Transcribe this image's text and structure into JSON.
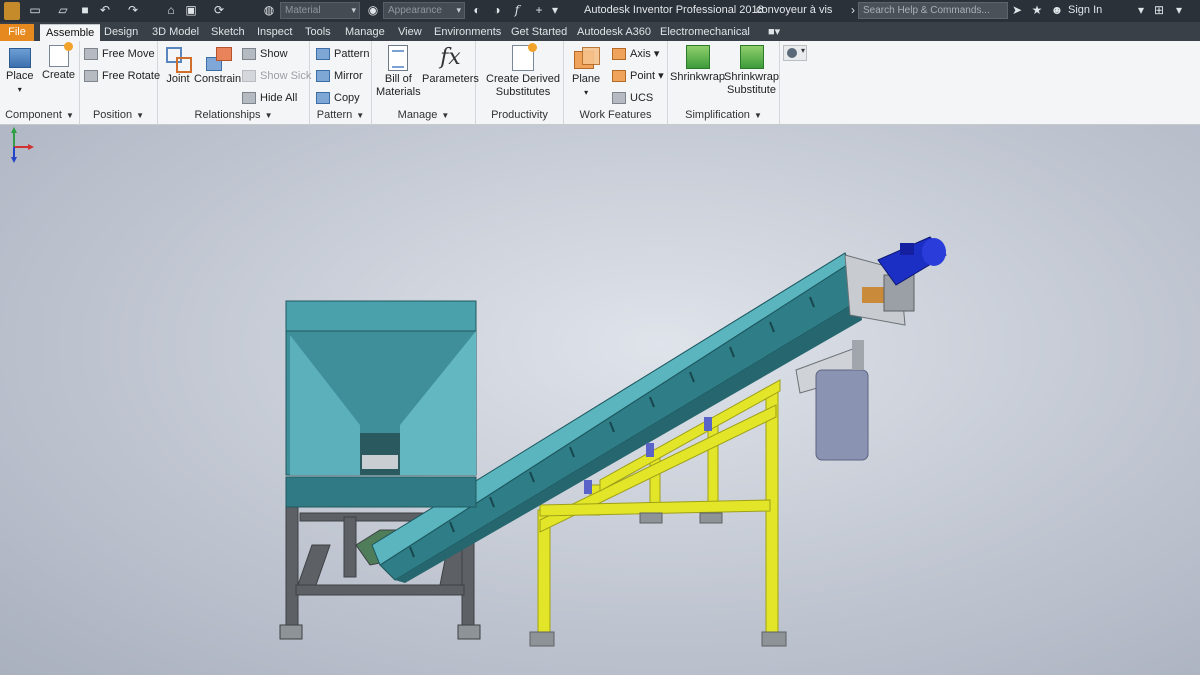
{
  "titlebar": {
    "app_title": "Autodesk Inventor Professional 2018",
    "document_title": "convoyeur à vis",
    "help_search_placeholder": "Search Help & Commands...",
    "sign_in": "Sign In",
    "material_combo": "Material",
    "appearance_combo": "Appearance"
  },
  "tabs": {
    "file": "File",
    "assemble": "Assemble",
    "design": "Design",
    "model3d": "3D Model",
    "sketch": "Sketch",
    "inspect": "Inspect",
    "tools": "Tools",
    "manage": "Manage",
    "view": "View",
    "environments": "Environments",
    "get_started": "Get Started",
    "a360": "Autodesk A360",
    "electromechanical": "Electromechanical"
  },
  "ribbon": {
    "component": {
      "title": "Component",
      "place": "Place",
      "create": "Create"
    },
    "position": {
      "title": "Position",
      "free_move": "Free Move",
      "free_rotate": "Free Rotate"
    },
    "relationships": {
      "title": "Relationships",
      "joint": "Joint",
      "constrain": "Constrain",
      "show": "Show",
      "show_sick": "Show Sick",
      "hide_all": "Hide All"
    },
    "pattern": {
      "title": "Pattern",
      "pattern": "Pattern",
      "mirror": "Mirror",
      "copy": "Copy"
    },
    "manage": {
      "title": "Manage",
      "bom_line1": "Bill of",
      "bom_line2": "Materials",
      "parameters": "Parameters"
    },
    "productivity": {
      "title": "Productivity",
      "derived_line1": "Create Derived",
      "derived_line2": "Substitutes"
    },
    "work_features": {
      "title": "Work Features",
      "plane": "Plane",
      "axis": "Axis",
      "point": "Point",
      "ucs": "UCS"
    },
    "simplification": {
      "title": "Simplification",
      "shrinkwrap": "Shrinkwrap",
      "shrinkwrap_sub_line1": "Shrinkwrap",
      "shrinkwrap_sub_line2": "Substitute"
    }
  },
  "icons": [
    "app-logo-icon",
    "new-icon",
    "open-icon",
    "save-icon",
    "undo-icon",
    "redo-icon",
    "home-icon",
    "select-icon",
    "update-icon",
    "color-icon",
    "fx-icon",
    "plus-icon",
    "help-icon",
    "star-icon",
    "user-icon",
    "cart-icon",
    "triad-icon"
  ],
  "colors": {
    "file_tab": "#e68a1f",
    "hopper": "#3f8f9a",
    "trough": "#3a8d97",
    "frame_yellow": "#e3e628",
    "frame_grey": "#5d6165",
    "motor": "#1c2fc4",
    "viewport_bg": "#c9ced8"
  }
}
